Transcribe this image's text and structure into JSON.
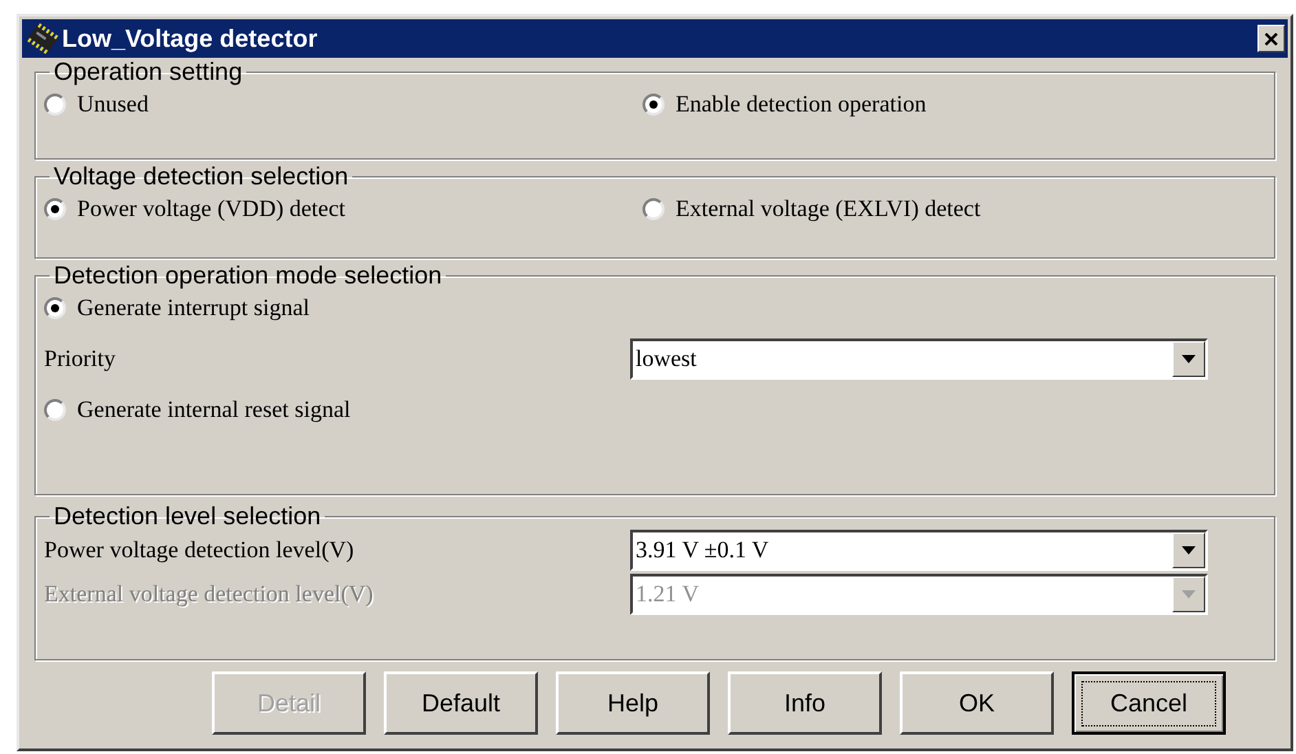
{
  "window": {
    "title": "Low_Voltage detector"
  },
  "operation_setting": {
    "title": "Operation setting",
    "options": [
      {
        "label": "Unused",
        "selected": false
      },
      {
        "label": "Enable detection operation",
        "selected": true
      }
    ]
  },
  "voltage_detection_selection": {
    "title": "Voltage detection selection",
    "options": [
      {
        "label": "Power voltage (VDD) detect",
        "selected": true
      },
      {
        "label": "External voltage (EXLVI) detect",
        "selected": false
      }
    ]
  },
  "detection_operation_mode_selection": {
    "title": "Detection operation mode selection",
    "items": [
      {
        "kind": "radio",
        "label": "Generate interrupt signal",
        "selected": true
      },
      {
        "kind": "combo",
        "label": "Priority",
        "value": "lowest",
        "disabled": false
      },
      {
        "kind": "radio",
        "label": "Generate internal reset signal",
        "selected": false
      }
    ]
  },
  "detection_level_selection": {
    "title": "Detection level selection",
    "rows": [
      {
        "label": "Power voltage detection level(V)",
        "value": "3.91 V ±0.1 V",
        "disabled": false
      },
      {
        "label": "External voltage detection level(V)",
        "value": "1.21 V",
        "disabled": true
      }
    ]
  },
  "buttons": [
    {
      "label": "Detail",
      "disabled": true,
      "focused": false
    },
    {
      "label": "Default",
      "disabled": false,
      "focused": false
    },
    {
      "label": "Help",
      "disabled": false,
      "focused": false
    },
    {
      "label": "Info",
      "disabled": false,
      "focused": false
    },
    {
      "label": "OK",
      "disabled": false,
      "focused": false
    },
    {
      "label": "Cancel",
      "disabled": false,
      "focused": true
    }
  ]
}
